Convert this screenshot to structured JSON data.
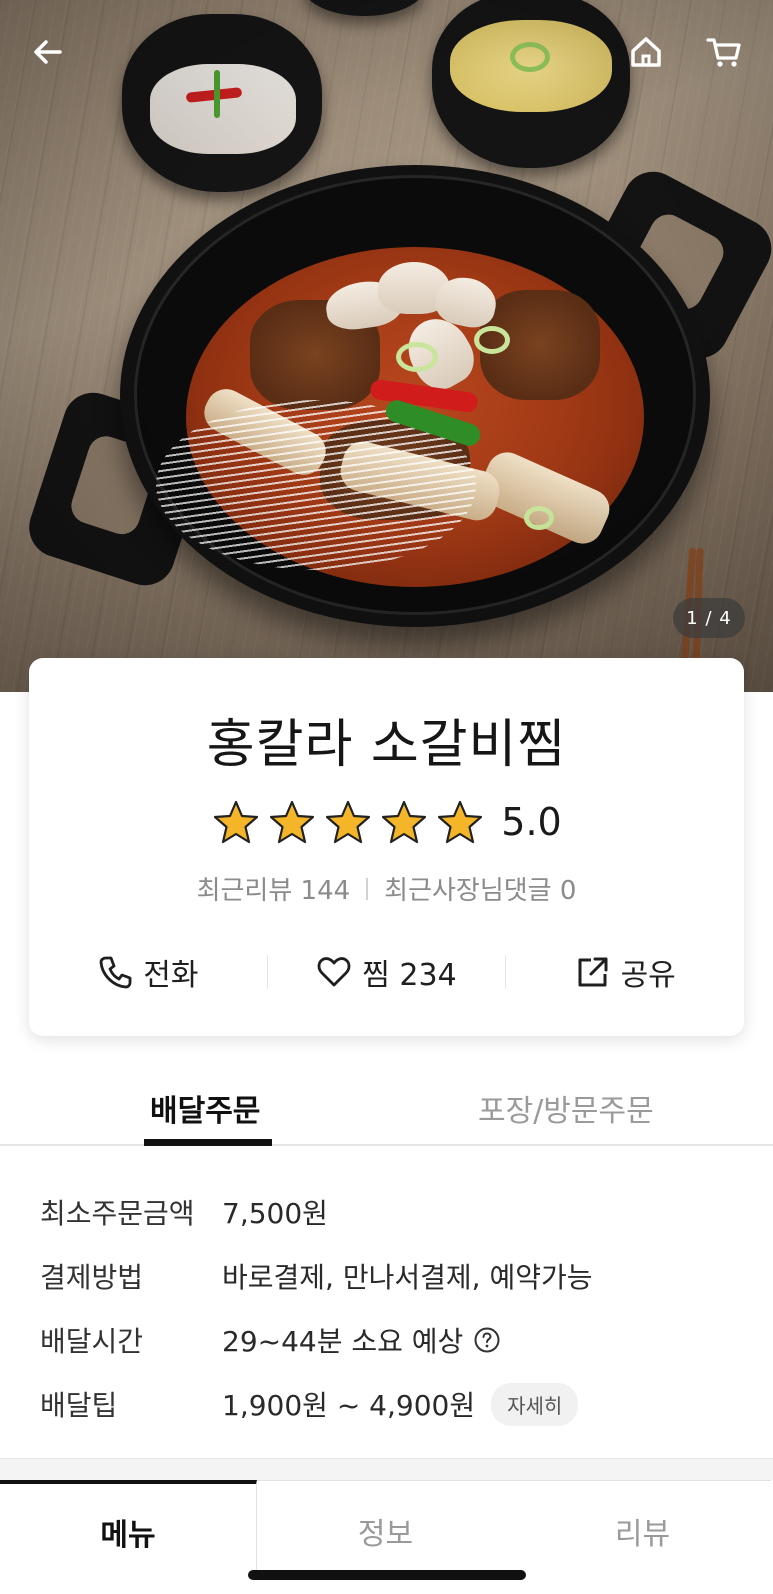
{
  "hero": {
    "image_counter": "1 / 4"
  },
  "header": {
    "back_icon": "arrow-left-icon",
    "home_icon": "home-icon",
    "cart_icon": "cart-icon"
  },
  "store": {
    "name": "홍칼라 소갈비찜",
    "rating": 5.0,
    "rating_text": "5.0",
    "stars_filled": 5,
    "star_color": "#f5b529",
    "recent_reviews": "최근리뷰 144",
    "owner_replies": "최근사장님댓글 0"
  },
  "actions": {
    "call": "전화",
    "like": "찜 234",
    "share": "공유"
  },
  "order_tabs": {
    "delivery": "배달주문",
    "pickup": "포장/방문주문"
  },
  "info": {
    "min_order_label": "최소주문금액",
    "min_order_value": "7,500원",
    "payment_label": "결제방법",
    "payment_value": "바로결제, 만나서결제, 예약가능",
    "delivery_time_label": "배달시간",
    "delivery_time_value": "29~44분 소요 예상",
    "delivery_tip_label": "배달팁",
    "delivery_tip_value": "1,900원 ~ 4,900원",
    "detail_button": "자세히"
  },
  "bottom_tabs": {
    "menu": "메뉴",
    "info": "정보",
    "review": "리뷰"
  }
}
